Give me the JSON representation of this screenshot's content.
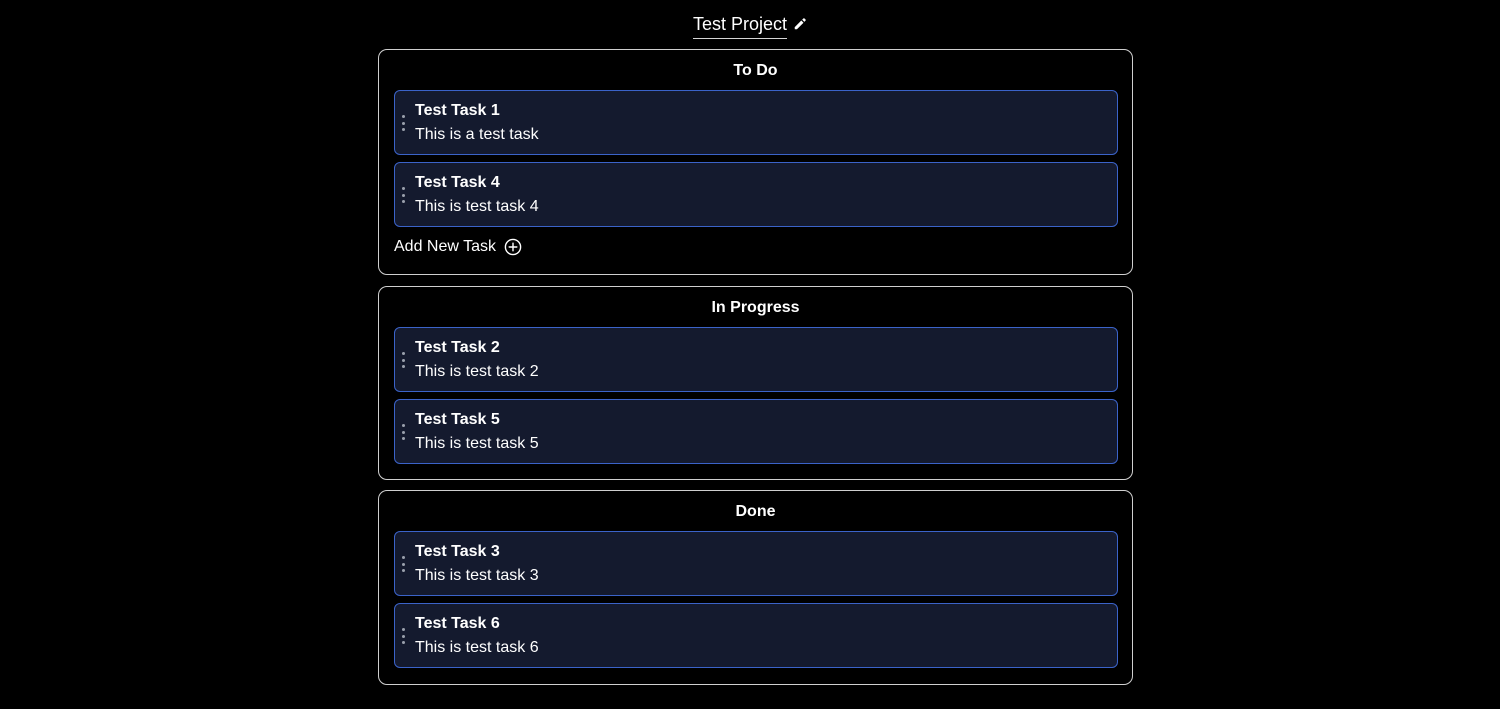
{
  "project": {
    "title": "Test Project",
    "edit_icon": "pencil-icon"
  },
  "columns": [
    {
      "title": "To Do",
      "tasks": [
        {
          "name": "Test Task 1",
          "description": "This is a test task"
        },
        {
          "name": "Test Task 4",
          "description": "This is test task 4"
        }
      ],
      "add_task_label": "Add New Task",
      "add_task_icon": "plus-circle-icon"
    },
    {
      "title": "In Progress",
      "tasks": [
        {
          "name": "Test Task 2",
          "description": "This is test task 2"
        },
        {
          "name": "Test Task 5",
          "description": "This is test task 5"
        }
      ]
    },
    {
      "title": "Done",
      "tasks": [
        {
          "name": "Test Task 3",
          "description": "This is test task 3"
        },
        {
          "name": "Test Task 6",
          "description": "This is test task 6"
        }
      ]
    }
  ],
  "colors": {
    "background": "#000000",
    "column_border": "#cfcfcf",
    "card_background": "#141a2e",
    "card_border": "#3b63c9",
    "text": "#ffffff"
  }
}
